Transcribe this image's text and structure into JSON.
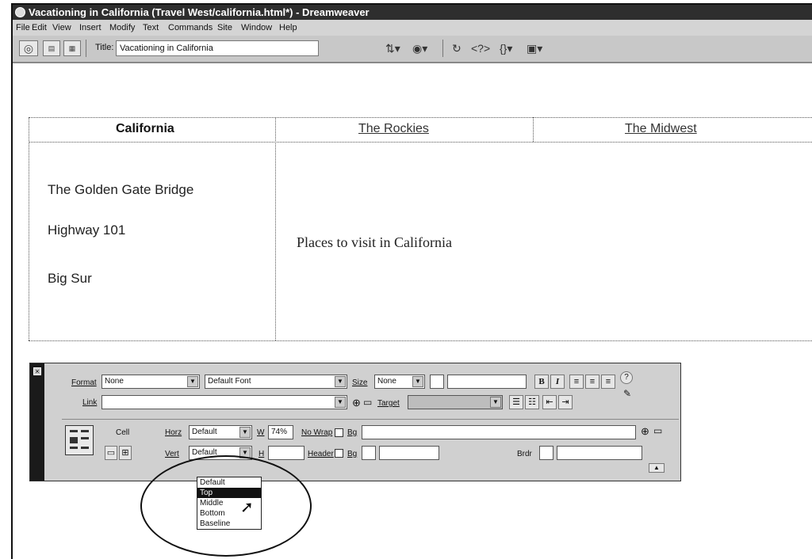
{
  "window": {
    "title": "Vacationing in California (Travel West/california.html*) - Dreamweaver"
  },
  "menu": [
    "File",
    "Edit",
    "View",
    "Insert",
    "Modify",
    "Text",
    "Commands",
    "Site",
    "Window",
    "Help"
  ],
  "toolbar": {
    "title_label": "Title:",
    "title_value": "Vacationing in California"
  },
  "document": {
    "nav": [
      "California",
      "The Rockies",
      "The Midwest"
    ],
    "left_items": [
      "The Golden Gate Bridge",
      "Highway 101",
      "Big Sur"
    ],
    "main_text": "Places to visit in California"
  },
  "inspector": {
    "format_label": "Format",
    "format_value": "None",
    "font_value": "Default Font",
    "size_label": "Size",
    "size_value": "None",
    "bold": "B",
    "italic": "I",
    "link_label": "Link",
    "target_label": "Target",
    "cell_label": "Cell",
    "horz_label": "Horz",
    "horz_value": "Default",
    "w_label": "W",
    "w_value": "74%",
    "nowrap_label": "No Wrap",
    "bg_label": "Bg",
    "vert_label": "Vert",
    "vert_value": "Default",
    "h_label": "H",
    "header_label": "Header",
    "bg2_label": "Bg",
    "brdr_label": "Brdr"
  },
  "vert_dropdown": {
    "options": [
      "Default",
      "Top",
      "Middle",
      "Bottom",
      "Baseline"
    ],
    "highlighted": "Top"
  }
}
